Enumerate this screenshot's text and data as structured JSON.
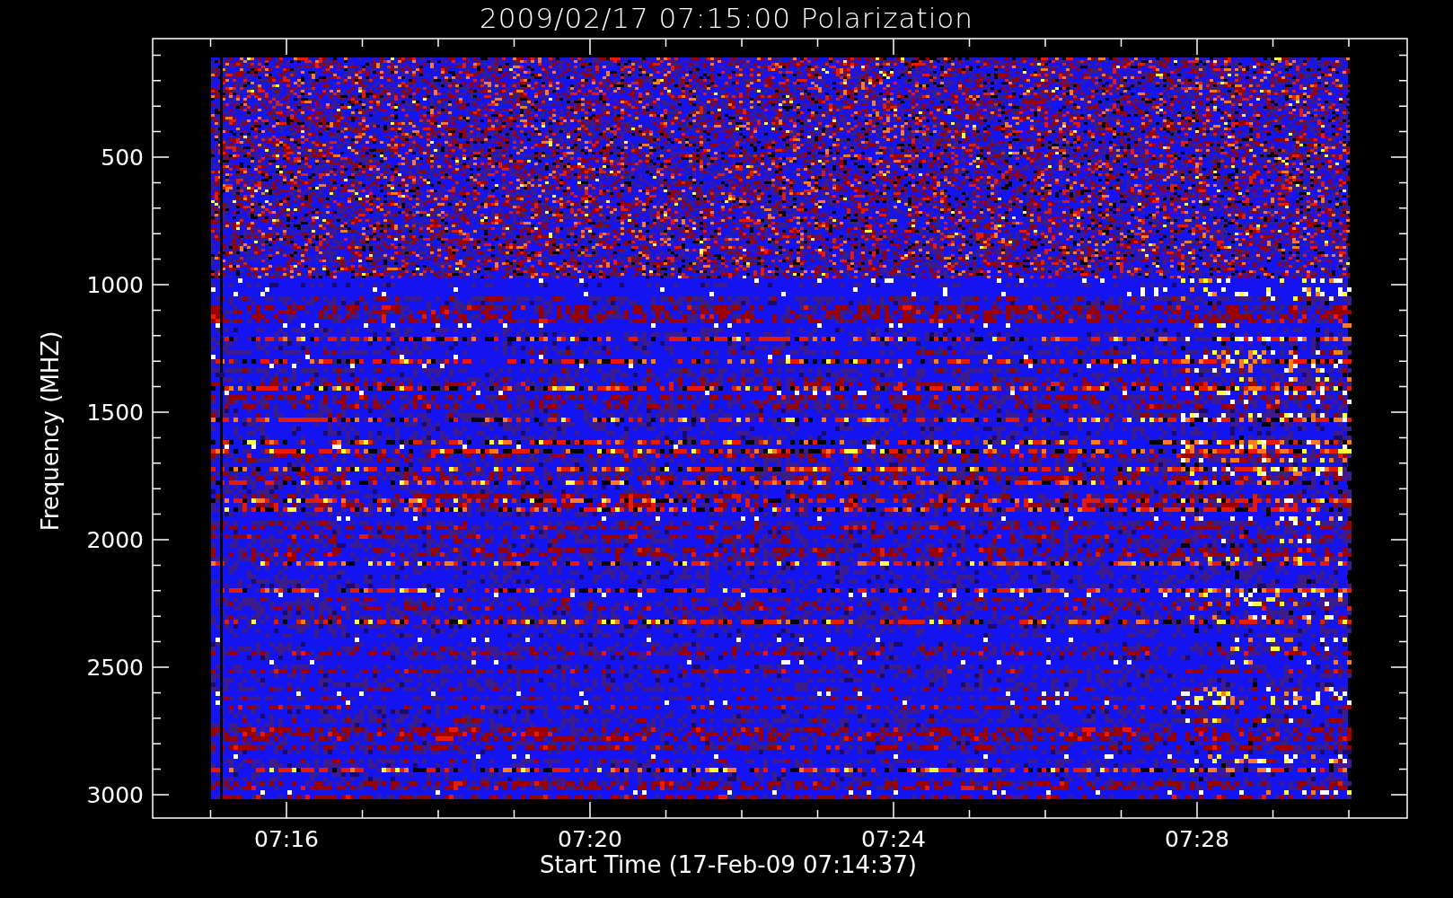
{
  "title": "2009/02/17 07:15:00 Polarization",
  "y_axis": {
    "label": "Frequency (MHZ)",
    "ticks": [
      "500",
      "1000",
      "1500",
      "2000",
      "2500",
      "3000"
    ]
  },
  "x_axis": {
    "label": "Start Time (17-Feb-09 07:14:37)",
    "ticks": [
      "07:16",
      "07:20",
      "07:24",
      "07:28"
    ]
  }
}
